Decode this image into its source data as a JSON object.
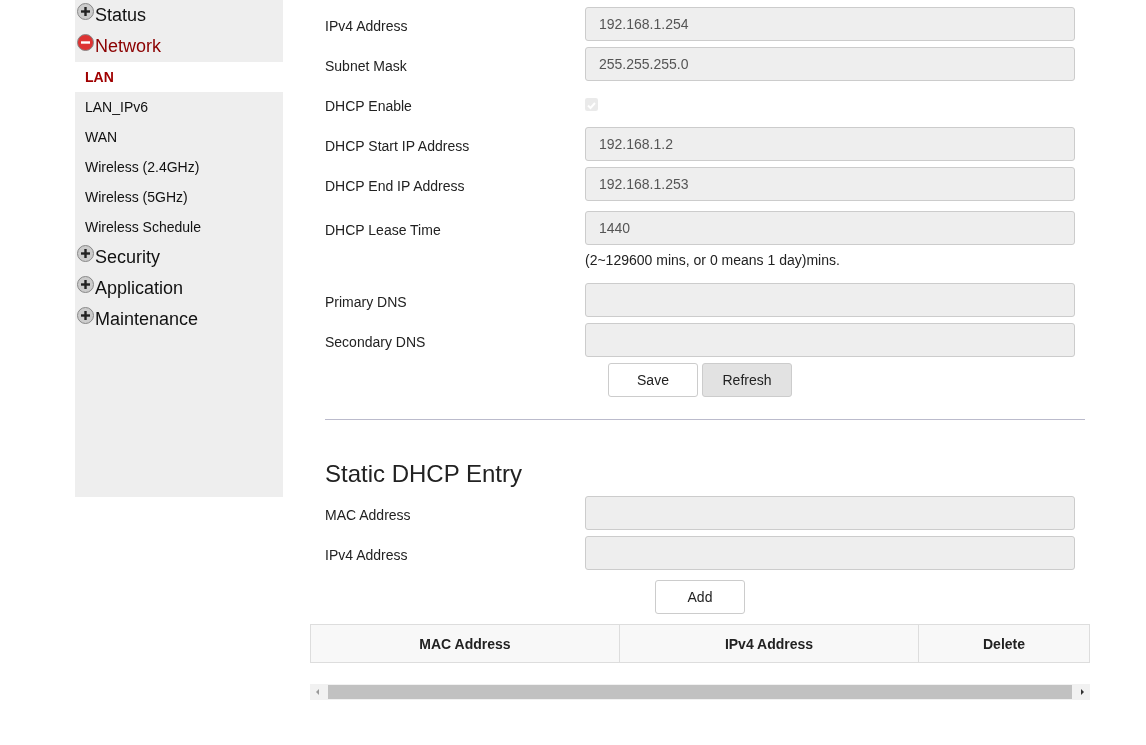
{
  "sidebar": {
    "groups": [
      {
        "label": "Status",
        "expanded": false
      },
      {
        "label": "Network",
        "expanded": true,
        "items": [
          {
            "label": "LAN",
            "selected": true
          },
          {
            "label": "LAN_IPv6",
            "selected": false
          },
          {
            "label": "WAN",
            "selected": false
          },
          {
            "label": "Wireless (2.4GHz)",
            "selected": false
          },
          {
            "label": "Wireless (5GHz)",
            "selected": false
          },
          {
            "label": "Wireless Schedule",
            "selected": false
          }
        ]
      },
      {
        "label": "Security",
        "expanded": false
      },
      {
        "label": "Application",
        "expanded": false
      },
      {
        "label": "Maintenance",
        "expanded": false
      }
    ]
  },
  "lan_form": {
    "fields": [
      {
        "kind": "text",
        "label": "IPv4 Address",
        "value": "192.168.1.254"
      },
      {
        "kind": "text",
        "label": "Subnet Mask",
        "value": "255.255.255.0"
      },
      {
        "kind": "checkbox",
        "label": "DHCP Enable",
        "checked": true,
        "disabled": true
      },
      {
        "kind": "text",
        "label": "DHCP Start IP Address",
        "value": "192.168.1.2"
      },
      {
        "kind": "text",
        "label": "DHCP End IP Address",
        "value": "192.168.1.253"
      },
      {
        "kind": "text",
        "label": "DHCP Lease Time",
        "value": "1440",
        "hint": "(2~129600 mins, or 0 means 1 day)mins."
      },
      {
        "kind": "text",
        "label": "Primary DNS"
      },
      {
        "kind": "text",
        "label": "Secondary DNS"
      }
    ],
    "buttons": [
      {
        "label": "Save",
        "kind": "default"
      },
      {
        "label": "Refresh",
        "kind": "grey"
      }
    ]
  },
  "static_dhcp": {
    "title": "Static DHCP Entry",
    "fields": [
      {
        "kind": "text",
        "label": "MAC Address"
      },
      {
        "kind": "text",
        "label": "IPv4 Address"
      }
    ],
    "button": "Add",
    "table": {
      "columns": [
        "MAC Address",
        "IPv4 Address",
        "Delete"
      ]
    }
  }
}
